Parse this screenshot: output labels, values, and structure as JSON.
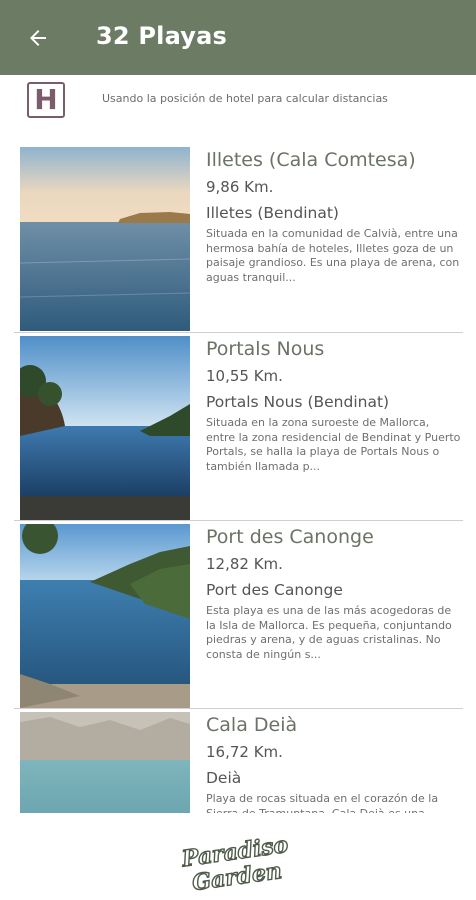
{
  "appbar": {
    "title": "32 Playas"
  },
  "hotel": {
    "badge": "H",
    "text": "Usando la posición de hotel para calcular distancias"
  },
  "beaches": [
    {
      "name": "Illetes (Cala Comtesa)",
      "distance": "9,86 Km.",
      "zone": "Illetes (Bendinat)",
      "description": "Situada en la comunidad de Calvià, entre una hermosa bahía de hoteles, Illetes goza de un paisaje grandioso. Es una playa de arena, con aguas tranquil..."
    },
    {
      "name": "Portals Nous",
      "distance": "10,55 Km.",
      "zone": "Portals Nous (Bendinat)",
      "description": "Situada en la zona suroeste de Mallorca, entre la zona residencial de Bendinat y Puerto Portals, se halla la playa de Portals Nous o también llamada p..."
    },
    {
      "name": "Port des Canonge",
      "distance": "12,82 Km.",
      "zone": "Port des Canonge",
      "description": "Esta playa es una de las más acogedoras de la Isla de Mallorca. Es pequeña, conjuntando piedras y arena, y de aguas cristalinas. No consta de ningún s..."
    },
    {
      "name": "Cala Deià",
      "distance": "16,72 Km.",
      "zone": "Deià",
      "description": "Playa de rocas situada en el corazón de la Sierra de Tramuntana. Cala Deià es una"
    }
  ],
  "logo": {
    "line1": "Paradiso",
    "line2": "Garden"
  },
  "colors": {
    "appbar": "#6b7b64",
    "hotel_badge": "#7a5c6c"
  },
  "icons": {
    "back": "arrow-left-icon",
    "hotel": "hotel-icon"
  }
}
